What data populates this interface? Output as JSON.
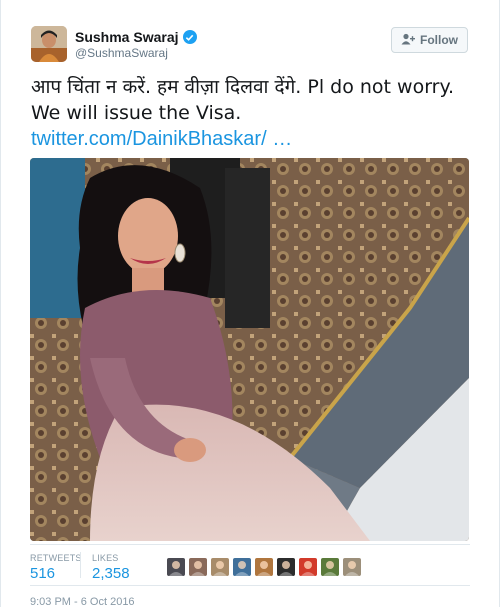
{
  "user": {
    "name": "Sushma Swaraj",
    "handle": "@SushmaSwaraj",
    "verified": true,
    "avatar_icon": "profile-photo"
  },
  "follow_button": {
    "label": "Follow",
    "icon": "add-person-icon"
  },
  "tweet": {
    "text": "आप चिंता न करें. हम वीज़ा दिलवा देंगे. Pl do not worry. We will  issue the Visa.",
    "link": "twitter.com/DainikBhaskar/ …"
  },
  "stats": {
    "retweets_label": "RETWEETS",
    "retweets": "516",
    "likes_label": "LIKES",
    "likes": "2,358"
  },
  "likers": [
    {
      "name": "liker-avatar-1",
      "color": "#4a4a52"
    },
    {
      "name": "liker-avatar-2",
      "color": "#8a6a5a"
    },
    {
      "name": "liker-avatar-3",
      "color": "#a88c6a"
    },
    {
      "name": "liker-avatar-4",
      "color": "#3f6f9a"
    },
    {
      "name": "liker-avatar-5",
      "color": "#b0763e"
    },
    {
      "name": "liker-avatar-6",
      "color": "#2c2c2c"
    },
    {
      "name": "liker-avatar-7",
      "color": "#d23a2a"
    },
    {
      "name": "liker-avatar-8",
      "color": "#5a7a3a"
    },
    {
      "name": "liker-avatar-9",
      "color": "#9c8f7a"
    }
  ],
  "timestamp": "9:03 PM - 6 Oct 2016",
  "colors": {
    "link": "#1b95e0",
    "verified": "#1da1f2",
    "muted": "#8899a6"
  }
}
